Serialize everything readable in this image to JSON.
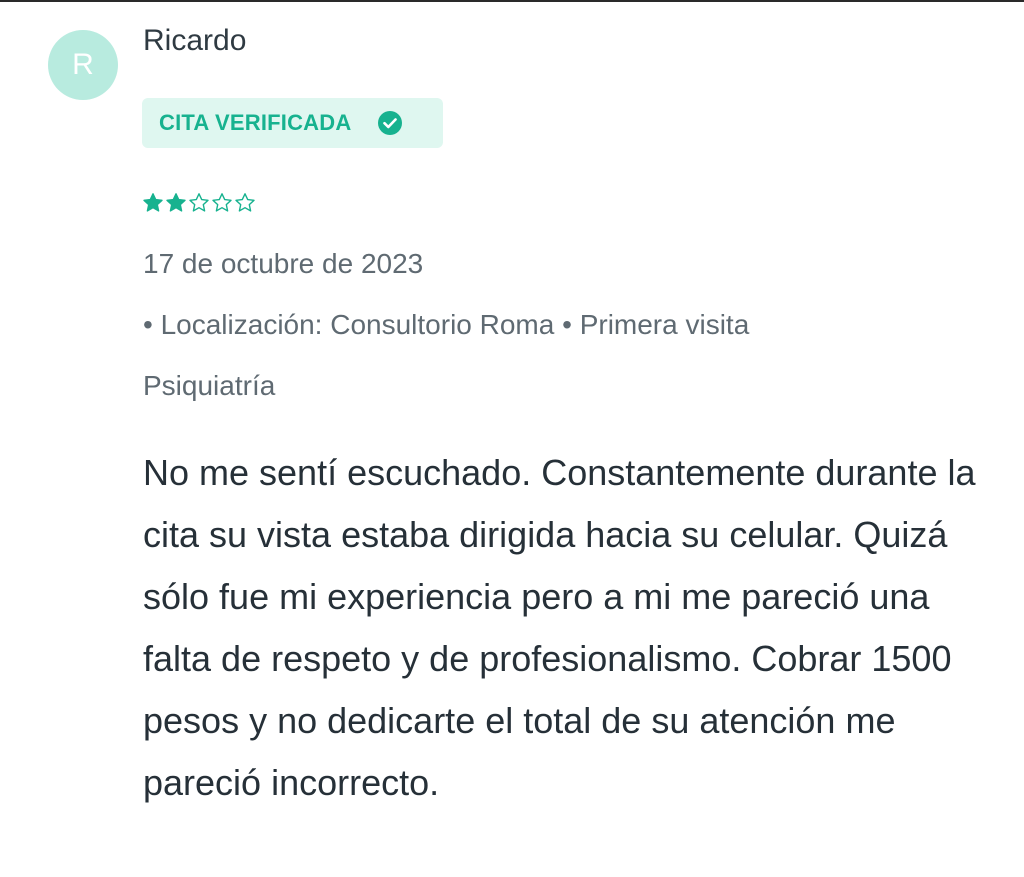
{
  "review": {
    "avatar_initial": "R",
    "author": "Ricardo",
    "badge_label": "CITA VERIFICADA",
    "rating": 2,
    "rating_max": 5,
    "date": "17 de octubre de 2023",
    "location_line": "• Localización: Consultorio Roma • Primera visita",
    "specialty": "Psiquiatría",
    "comment": "No me sentí escuchado. Constantemente durante la cita su vista estaba dirigida hacia su celular. Quizá sólo fue mi experiencia pero a mi me pareció una falta de respeto y de profesionalismo. Cobrar 1500 pesos y no dedicarte el total de su atención me pareció incorrecto."
  },
  "icons": {
    "badge": "check-circle-icon",
    "star": "star-icon"
  },
  "colors": {
    "accent": "#17b28f",
    "badge_bg": "#dff7f0",
    "avatar_bg": "#b8ebdf",
    "star_fill": "#17b28f"
  }
}
